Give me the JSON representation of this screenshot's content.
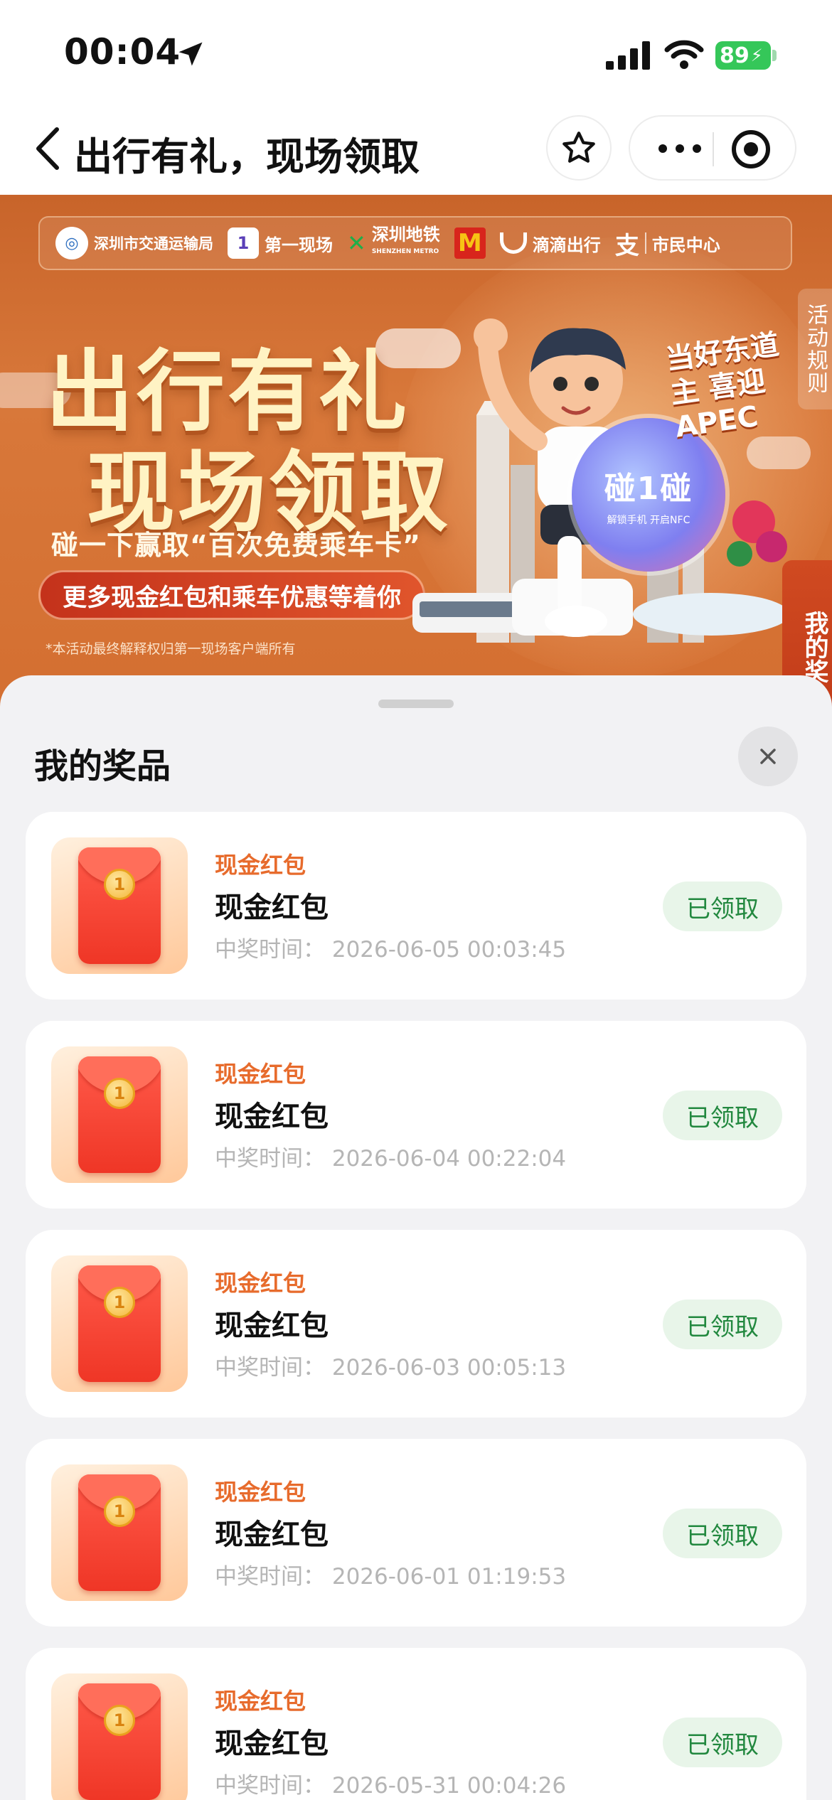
{
  "status_bar": {
    "time": "00:04",
    "battery": "89"
  },
  "nav": {
    "title": "出行有礼，现场领取"
  },
  "banner": {
    "logos": [
      "深圳市交通运输局",
      "第一现场",
      "深圳地铁",
      "滴滴出行",
      "支",
      "市民中心"
    ],
    "metro_sub": "SHENZHEN METRO",
    "headline1": "出行有礼",
    "headline2": "现场领取",
    "subtitle": "碰一下赢取“百次免费乘车卡”",
    "pill": "更多现金红包和乘车优惠等着你",
    "note": "*本活动最终解释权归第一现场客户端所有",
    "apec": "当好东道主 喜迎APEC",
    "nfc_title": "碰1碰",
    "nfc_sub": "解锁手机 开启NFC",
    "rules_tab": "活动规则",
    "my_prize_tab": "我的奖"
  },
  "sheet": {
    "title": "我的奖品",
    "items": [
      {
        "tag": "现金红包",
        "name": "现金红包",
        "time": "中奖时间： 2026-06-05 00:03:45",
        "status": "已领取"
      },
      {
        "tag": "现金红包",
        "name": "现金红包",
        "time": "中奖时间： 2026-06-04 00:22:04",
        "status": "已领取"
      },
      {
        "tag": "现金红包",
        "name": "现金红包",
        "time": "中奖时间： 2026-06-03 00:05:13",
        "status": "已领取"
      },
      {
        "tag": "现金红包",
        "name": "现金红包",
        "time": "中奖时间： 2026-06-01 01:19:53",
        "status": "已领取"
      },
      {
        "tag": "现金红包",
        "name": "现金红包",
        "time": "中奖时间： 2026-05-31 00:04:26",
        "status": "已领取"
      }
    ]
  },
  "icons": [
    "location-arrow-icon",
    "signal-icon",
    "wifi-icon",
    "battery-icon",
    "back-chevron-icon",
    "star-icon",
    "more-dots-icon",
    "target-close-icon",
    "close-icon",
    "red-envelope-icon"
  ],
  "colors": {
    "accent": "#e76b2c",
    "success": "#22883f",
    "banner": "#d8783a"
  }
}
